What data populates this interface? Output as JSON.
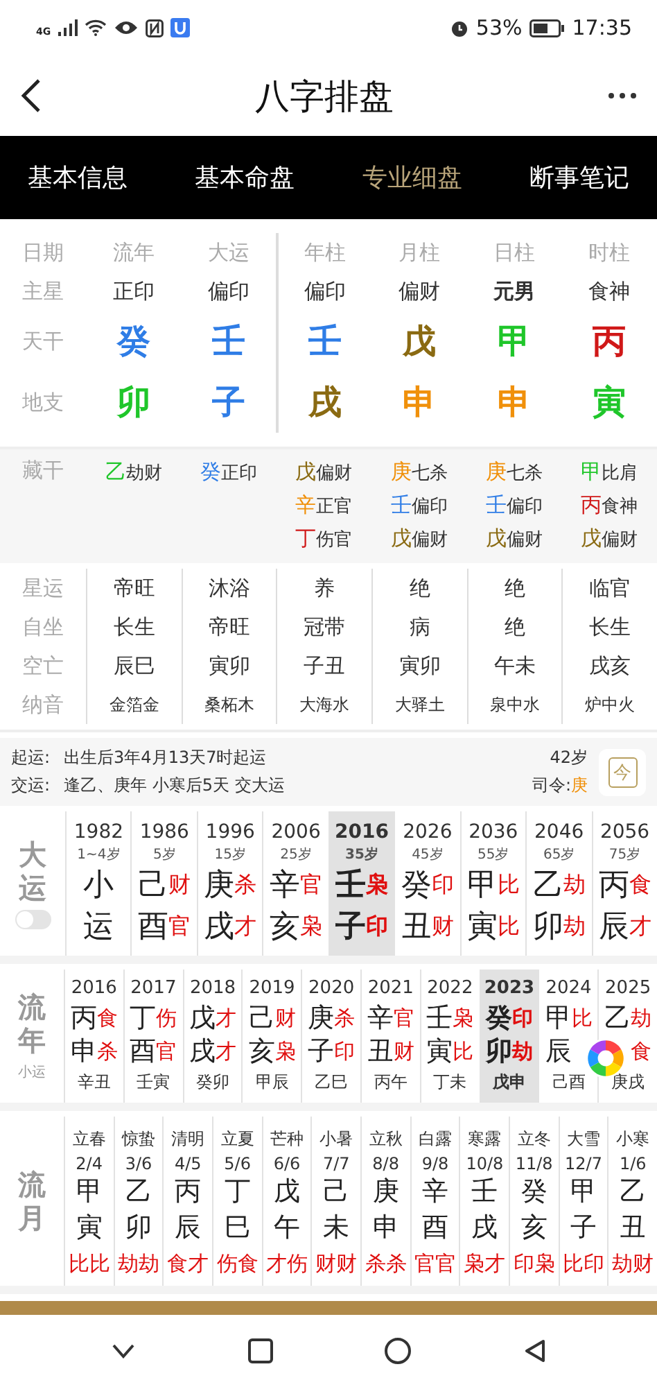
{
  "status_bar": {
    "network": "4G",
    "battery": "53%",
    "time": "17:35"
  },
  "header": {
    "title": "八字排盘"
  },
  "tabs": [
    {
      "label": "基本信息",
      "selected": false
    },
    {
      "label": "基本命盘",
      "selected": false
    },
    {
      "label": "专业细盘",
      "selected": true
    },
    {
      "label": "断事笔记",
      "selected": false
    }
  ],
  "pillars": {
    "row_labels": [
      "日期",
      "主星",
      "天干",
      "地支"
    ],
    "luck_columns": [
      {
        "date": "流年",
        "star": "正印",
        "emphasized": false,
        "stem": {
          "char": "癸",
          "color": "#2f7de6"
        },
        "branch": {
          "char": "卯",
          "color": "#1fc62a"
        }
      },
      {
        "date": "大运",
        "star": "偏印",
        "emphasized": false,
        "stem": {
          "char": "壬",
          "color": "#2f7de6"
        },
        "branch": {
          "char": "子",
          "color": "#2f7de6"
        }
      }
    ],
    "natal_columns": [
      {
        "date": "年柱",
        "star": "偏印",
        "emphasized": false,
        "stem": {
          "char": "壬",
          "color": "#2f7de6"
        },
        "branch": {
          "char": "戌",
          "color": "#8a6a12"
        }
      },
      {
        "date": "月柱",
        "star": "偏财",
        "emphasized": false,
        "stem": {
          "char": "戊",
          "color": "#8a6a12"
        },
        "branch": {
          "char": "申",
          "color": "#f0900a"
        }
      },
      {
        "date": "日柱",
        "star": "元男",
        "emphasized": true,
        "stem": {
          "char": "甲",
          "color": "#1fc62a"
        },
        "branch": {
          "char": "申",
          "color": "#f0900a"
        }
      },
      {
        "date": "时柱",
        "star": "食神",
        "emphasized": false,
        "stem": {
          "char": "丙",
          "color": "#d01818"
        },
        "branch": {
          "char": "寅",
          "color": "#1fc62a"
        }
      }
    ]
  },
  "hidden_stems": {
    "label": "藏干",
    "columns": [
      [
        {
          "stem": "乙",
          "color": "#1fc62a",
          "god": "劫财"
        }
      ],
      [
        {
          "stem": "癸",
          "color": "#2f7de6",
          "god": "正印"
        }
      ],
      [
        {
          "stem": "戊",
          "color": "#8a6a12",
          "god": "偏财"
        },
        {
          "stem": "辛",
          "color": "#f0900a",
          "god": "正官"
        },
        {
          "stem": "丁",
          "color": "#d01818",
          "god": "伤官"
        }
      ],
      [
        {
          "stem": "庚",
          "color": "#f0900a",
          "god": "七杀"
        },
        {
          "stem": "壬",
          "color": "#2f7de6",
          "god": "偏印"
        },
        {
          "stem": "戊",
          "color": "#8a6a12",
          "god": "偏财"
        }
      ],
      [
        {
          "stem": "庚",
          "color": "#f0900a",
          "god": "七杀"
        },
        {
          "stem": "壬",
          "color": "#2f7de6",
          "god": "偏印"
        },
        {
          "stem": "戊",
          "color": "#8a6a12",
          "god": "偏财"
        }
      ],
      [
        {
          "stem": "甲",
          "color": "#1fc62a",
          "god": "比肩"
        },
        {
          "stem": "丙",
          "color": "#d01818",
          "god": "食神"
        },
        {
          "stem": "戊",
          "color": "#8a6a12",
          "god": "偏财"
        }
      ]
    ]
  },
  "stages": [
    {
      "label": "星运",
      "values": [
        "帝旺",
        "沐浴",
        "养",
        "绝",
        "绝",
        "临官"
      ]
    },
    {
      "label": "自坐",
      "values": [
        "长生",
        "帝旺",
        "冠带",
        "病",
        "绝",
        "长生"
      ]
    },
    {
      "label": "空亡",
      "values": [
        "辰巳",
        "寅卯",
        "子丑",
        "寅卯",
        "午未",
        "戌亥"
      ]
    },
    {
      "label": "纳音",
      "values": [
        "金箔金",
        "桑柘木",
        "大海水",
        "大驿土",
        "泉中水",
        "炉中火"
      ]
    }
  ],
  "luck_info": {
    "start_label": "起运:",
    "start_text": "出生后3年4月13天7时起运",
    "change_label": "交运:",
    "change_text": "逢乙、庚年 小寒后5天 交大运",
    "age": "42岁",
    "commander_label": "司令:",
    "commander": "庚",
    "today_button": "今"
  },
  "dayun": {
    "title": "大运",
    "toggle_on": false,
    "items": [
      {
        "year": "1982",
        "age": "1~4岁",
        "stem": "小",
        "branch": "运",
        "selected": false
      },
      {
        "year": "1986",
        "age": "5岁",
        "stem": "己",
        "stem_god": "财",
        "branch": "酉",
        "branch_god": "官",
        "selected": false
      },
      {
        "year": "1996",
        "age": "15岁",
        "stem": "庚",
        "stem_god": "杀",
        "branch": "戌",
        "branch_god": "才",
        "selected": false
      },
      {
        "year": "2006",
        "age": "25岁",
        "stem": "辛",
        "stem_god": "官",
        "branch": "亥",
        "branch_god": "枭",
        "selected": false
      },
      {
        "year": "2016",
        "age": "35岁",
        "stem": "壬",
        "stem_god": "枭",
        "branch": "子",
        "branch_god": "印",
        "selected": true
      },
      {
        "year": "2026",
        "age": "45岁",
        "stem": "癸",
        "stem_god": "印",
        "branch": "丑",
        "branch_god": "财",
        "selected": false
      },
      {
        "year": "2036",
        "age": "55岁",
        "stem": "甲",
        "stem_god": "比",
        "branch": "寅",
        "branch_god": "比",
        "selected": false
      },
      {
        "year": "2046",
        "age": "65岁",
        "stem": "乙",
        "stem_god": "劫",
        "branch": "卯",
        "branch_god": "劫",
        "selected": false
      },
      {
        "year": "2056",
        "age": "75岁",
        "stem": "丙",
        "stem_god": "食",
        "branch": "辰",
        "branch_god": "才",
        "selected": false
      }
    ]
  },
  "liunian": {
    "title": "流年",
    "subtitle": "小运",
    "items": [
      {
        "year": "2016",
        "stem": "丙",
        "stem_god": "食",
        "branch": "申",
        "branch_god": "杀",
        "xiaoyun": "辛丑",
        "selected": false
      },
      {
        "year": "2017",
        "stem": "丁",
        "stem_god": "伤",
        "branch": "酉",
        "branch_god": "官",
        "xiaoyun": "壬寅",
        "selected": false
      },
      {
        "year": "2018",
        "stem": "戊",
        "stem_god": "才",
        "branch": "戌",
        "branch_god": "才",
        "xiaoyun": "癸卯",
        "selected": false
      },
      {
        "year": "2019",
        "stem": "己",
        "stem_god": "财",
        "branch": "亥",
        "branch_god": "枭",
        "xiaoyun": "甲辰",
        "selected": false
      },
      {
        "year": "2020",
        "stem": "庚",
        "stem_god": "杀",
        "branch": "子",
        "branch_god": "印",
        "xiaoyun": "乙巳",
        "selected": false
      },
      {
        "year": "2021",
        "stem": "辛",
        "stem_god": "官",
        "branch": "丑",
        "branch_god": "财",
        "xiaoyun": "丙午",
        "selected": false
      },
      {
        "year": "2022",
        "stem": "壬",
        "stem_god": "枭",
        "branch": "寅",
        "branch_god": "比",
        "xiaoyun": "丁未",
        "selected": false
      },
      {
        "year": "2023",
        "stem": "癸",
        "stem_god": "印",
        "branch": "卯",
        "branch_god": "劫",
        "xiaoyun": "戊申",
        "selected": true
      },
      {
        "year": "2024",
        "stem": "甲",
        "stem_god": "比",
        "branch": "辰",
        "xiaoyun": "己酉",
        "selected": false
      },
      {
        "year": "2025",
        "stem": "乙",
        "stem_god": "劫",
        "branch_god": "食",
        "xiaoyun": "庚戌",
        "selected": false
      }
    ]
  },
  "liuyue": {
    "title": "流月",
    "items": [
      {
        "term": "立春",
        "date": "2/4",
        "stem": "甲",
        "branch": "寅",
        "gods": "比比"
      },
      {
        "term": "惊蛰",
        "date": "3/6",
        "stem": "乙",
        "branch": "卯",
        "gods": "劫劫"
      },
      {
        "term": "清明",
        "date": "4/5",
        "stem": "丙",
        "branch": "辰",
        "gods": "食才"
      },
      {
        "term": "立夏",
        "date": "5/6",
        "stem": "丁",
        "branch": "巳",
        "gods": "伤食"
      },
      {
        "term": "芒种",
        "date": "6/6",
        "stem": "戊",
        "branch": "午",
        "gods": "才伤"
      },
      {
        "term": "小暑",
        "date": "7/7",
        "stem": "己",
        "branch": "未",
        "gods": "财财"
      },
      {
        "term": "立秋",
        "date": "8/8",
        "stem": "庚",
        "branch": "申",
        "gods": "杀杀"
      },
      {
        "term": "白露",
        "date": "9/8",
        "stem": "辛",
        "branch": "酉",
        "gods": "官官"
      },
      {
        "term": "寒露",
        "date": "10/8",
        "stem": "壬",
        "branch": "戌",
        "gods": "枭才"
      },
      {
        "term": "立冬",
        "date": "11/8",
        "stem": "癸",
        "branch": "亥",
        "gods": "印枭"
      },
      {
        "term": "大雪",
        "date": "12/7",
        "stem": "甲",
        "branch": "子",
        "gods": "比印"
      },
      {
        "term": "小寒",
        "date": "1/6",
        "stem": "乙",
        "branch": "丑",
        "gods": "劫财"
      }
    ]
  }
}
